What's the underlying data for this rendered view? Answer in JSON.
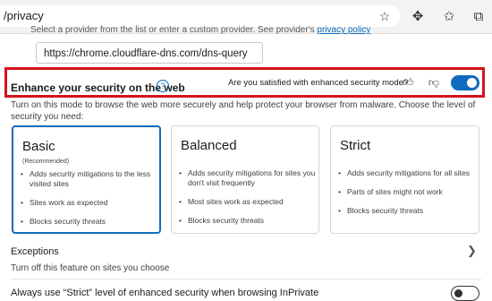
{
  "browser": {
    "url": "/privacy",
    "icons": [
      "add-favorite-icon",
      "extensions-icon",
      "favorites-icon",
      "collections-icon"
    ]
  },
  "dns": {
    "cutoff_text": "Select a provider from the list or enter a custom provider. See provider's",
    "cutoff_link": "privacy policy",
    "input_value": "https://chrome.cloudflare-dns.com/dns-query"
  },
  "enhance": {
    "title": "Enhance your security on the web",
    "help": "?",
    "satisfied_question": "Are you satisfied with enhanced security mode?",
    "enabled": true,
    "description": "Turn on this mode to browse the web more securely and help protect your browser from malware. Choose the level of security you need:"
  },
  "levels": [
    {
      "title": "Basic",
      "subtitle": "(Recommended)",
      "selected": true,
      "bullets": [
        "Adds security mitigations to the less visited sites",
        "Sites work as expected",
        "Blocks security threats"
      ]
    },
    {
      "title": "Balanced",
      "subtitle": "",
      "selected": false,
      "bullets": [
        "Adds security mitigations for sites you don't visit frequently",
        "Most sites work as expected",
        "Blocks security threats"
      ]
    },
    {
      "title": "Strict",
      "subtitle": "",
      "selected": false,
      "bullets": [
        "Adds security mitigations for all sites",
        "Parts of sites might not work",
        "Blocks security threats"
      ]
    }
  ],
  "exceptions": {
    "title": "Exceptions",
    "description": "Turn off this feature on sites you choose"
  },
  "inprivate": {
    "label": "Always use “Strict” level of enhanced security when browsing InPrivate",
    "enabled": false
  },
  "colors": {
    "accent": "#0f6cbd",
    "highlight": "#d6111f"
  }
}
